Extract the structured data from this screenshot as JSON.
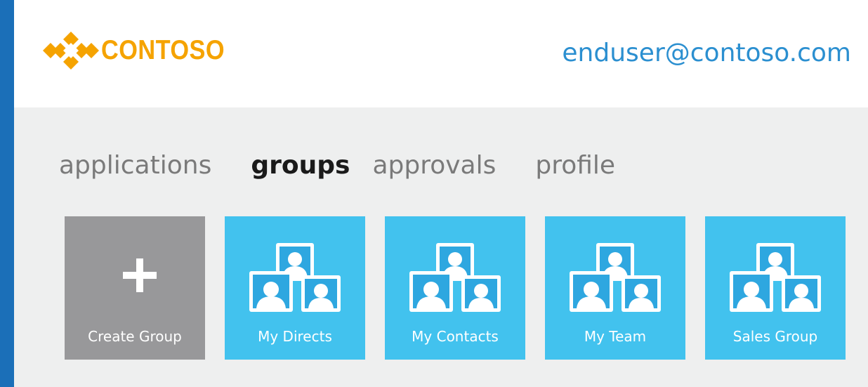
{
  "theme": {
    "accent": "#1b6fb8",
    "logo_color": "#f5a300",
    "email_color": "#2b8fd0",
    "create_tile_color": "#98989a",
    "group_tile_color": "#42c2ee",
    "icon_color": "#2ea7e0"
  },
  "header": {
    "logo_text": "CONTOSO",
    "logo_icon": "contoso-logo-mark",
    "user_email": "enduser@contoso.com"
  },
  "nav": {
    "items": [
      {
        "label": "applications",
        "active": false
      },
      {
        "label": "groups",
        "active": true
      },
      {
        "label": "approvals",
        "active": false
      },
      {
        "label": "profile",
        "active": false
      }
    ]
  },
  "tiles": [
    {
      "label": "Create Group",
      "icon": "plus-icon"
    },
    {
      "label": "My Directs",
      "icon": "group-icon"
    },
    {
      "label": "My Contacts",
      "icon": "group-icon"
    },
    {
      "label": "My Team",
      "icon": "group-icon"
    },
    {
      "label": "Sales Group",
      "icon": "group-icon"
    }
  ]
}
